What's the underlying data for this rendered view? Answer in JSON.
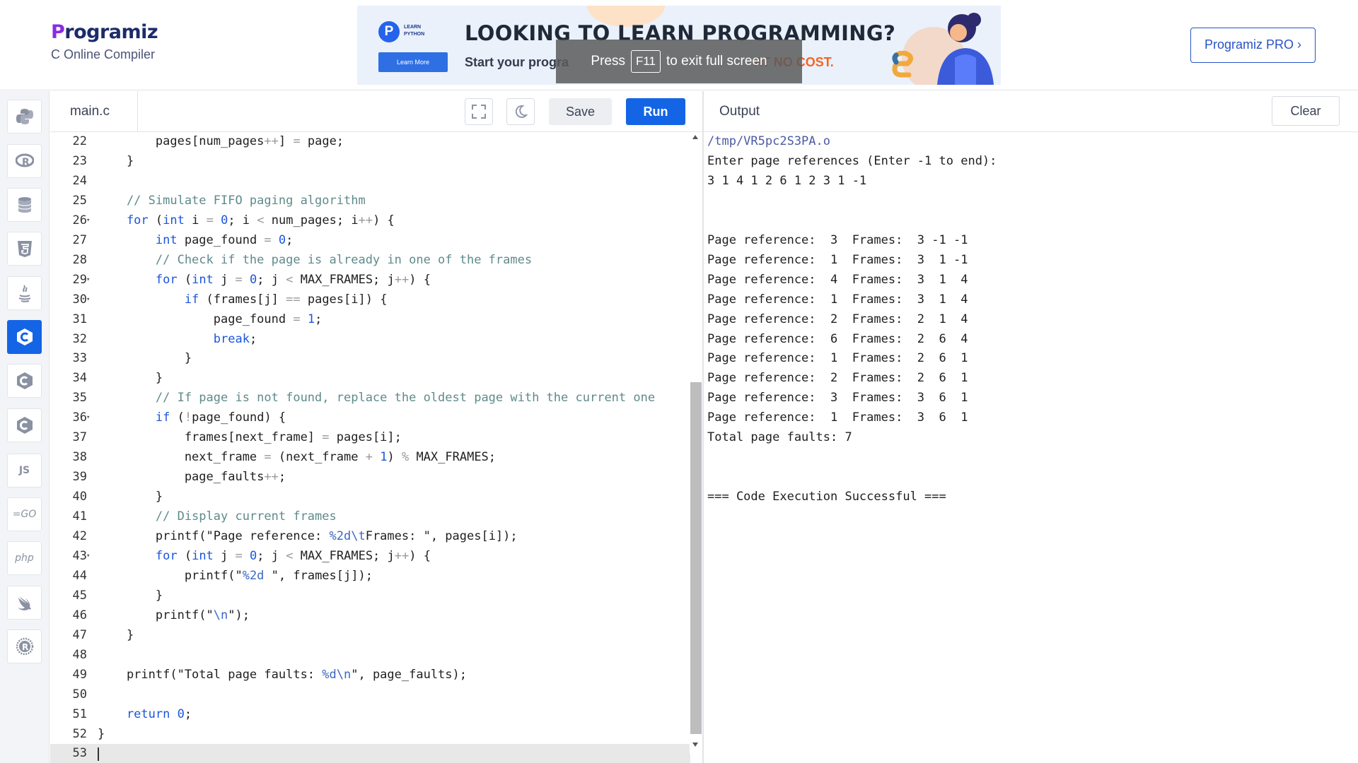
{
  "header": {
    "logo_text": "Programiz",
    "subtitle": "C Online Compiler",
    "pro_button": "Programiz PRO ›"
  },
  "banner": {
    "badge_text_1": "LEARN",
    "badge_text_2": "PYTHON",
    "badge_button": "Learn More",
    "headline": "LOOKING TO LEARN PROGRAMMING?",
    "subline_prefix": "Start your progra",
    "subline_highlight": "AT NO COST."
  },
  "toast": {
    "before": "Press",
    "key": "F11",
    "after": "to exit full screen"
  },
  "sidebar": {
    "items": [
      {
        "name": "python",
        "icon": "python-icon"
      },
      {
        "name": "r",
        "icon": "r-icon"
      },
      {
        "name": "sql",
        "icon": "database-icon"
      },
      {
        "name": "html",
        "icon": "html5-icon"
      },
      {
        "name": "java",
        "icon": "java-icon"
      },
      {
        "name": "c",
        "icon": "c-icon",
        "active": true
      },
      {
        "name": "cpp",
        "icon": "cpp-icon"
      },
      {
        "name": "csharp",
        "icon": "csharp-icon"
      },
      {
        "name": "js",
        "icon": "js-icon",
        "label": "JS"
      },
      {
        "name": "go",
        "icon": "go-icon",
        "label": "GO"
      },
      {
        "name": "php",
        "icon": "php-icon",
        "label": "php"
      },
      {
        "name": "swift",
        "icon": "swift-icon"
      },
      {
        "name": "rust",
        "icon": "rust-icon"
      }
    ]
  },
  "editor": {
    "file_tab": "main.c",
    "save_label": "Save",
    "run_label": "Run",
    "current_line": 53,
    "lines": [
      {
        "n": "22",
        "fold": false,
        "code": [
          [
            "",
            "        pages[num_pages"
          ],
          [
            "o",
            "++"
          ],
          [
            "",
            "] "
          ],
          [
            "o",
            "="
          ],
          [
            "",
            " page;"
          ]
        ]
      },
      {
        "n": "23",
        "fold": false,
        "code": [
          [
            "",
            "    }"
          ]
        ]
      },
      {
        "n": "24",
        "fold": false,
        "code": []
      },
      {
        "n": "25",
        "fold": false,
        "code": [
          [
            "c",
            "    // Simulate FIFO paging algorithm"
          ]
        ]
      },
      {
        "n": "26",
        "fold": true,
        "code": [
          [
            "k",
            "    for"
          ],
          [
            "",
            " ("
          ],
          [
            "k",
            "int"
          ],
          [
            "",
            " i "
          ],
          [
            "o",
            "="
          ],
          [
            "",
            " "
          ],
          [
            "n",
            "0"
          ],
          [
            "",
            "; i "
          ],
          [
            "o",
            "<"
          ],
          [
            "",
            " num_pages; i"
          ],
          [
            "o",
            "++"
          ],
          [
            "",
            ") {"
          ]
        ]
      },
      {
        "n": "27",
        "fold": false,
        "code": [
          [
            "k",
            "        int"
          ],
          [
            "",
            " page_found "
          ],
          [
            "o",
            "="
          ],
          [
            "",
            " "
          ],
          [
            "n",
            "0"
          ],
          [
            "",
            ";"
          ]
        ]
      },
      {
        "n": "28",
        "fold": false,
        "code": [
          [
            "c",
            "        // Check if the page is already in one of the frames"
          ]
        ]
      },
      {
        "n": "29",
        "fold": true,
        "code": [
          [
            "k",
            "        for"
          ],
          [
            "",
            " ("
          ],
          [
            "k",
            "int"
          ],
          [
            "",
            " j "
          ],
          [
            "o",
            "="
          ],
          [
            "",
            " "
          ],
          [
            "n",
            "0"
          ],
          [
            "",
            "; j "
          ],
          [
            "o",
            "<"
          ],
          [
            "",
            " MAX_FRAMES; j"
          ],
          [
            "o",
            "++"
          ],
          [
            "",
            ") {"
          ]
        ]
      },
      {
        "n": "30",
        "fold": true,
        "code": [
          [
            "k",
            "            if"
          ],
          [
            "",
            " (frames[j] "
          ],
          [
            "o",
            "=="
          ],
          [
            "",
            " pages[i]) {"
          ]
        ]
      },
      {
        "n": "31",
        "fold": false,
        "code": [
          [
            "",
            "                page_found "
          ],
          [
            "o",
            "="
          ],
          [
            "",
            " "
          ],
          [
            "n",
            "1"
          ],
          [
            "",
            ";"
          ]
        ]
      },
      {
        "n": "32",
        "fold": false,
        "code": [
          [
            "k",
            "                break"
          ],
          [
            "",
            ";"
          ]
        ]
      },
      {
        "n": "33",
        "fold": false,
        "code": [
          [
            "",
            "            }"
          ]
        ]
      },
      {
        "n": "34",
        "fold": false,
        "code": [
          [
            "",
            "        }"
          ]
        ]
      },
      {
        "n": "35",
        "fold": false,
        "code": [
          [
            "c",
            "        // If page is not found, replace the oldest page with the current one"
          ]
        ]
      },
      {
        "n": "36",
        "fold": true,
        "code": [
          [
            "k",
            "        if"
          ],
          [
            "",
            " ("
          ],
          [
            "o",
            "!"
          ],
          [
            "",
            "page_found) {"
          ]
        ]
      },
      {
        "n": "37",
        "fold": false,
        "code": [
          [
            "",
            "            frames[next_frame] "
          ],
          [
            "o",
            "="
          ],
          [
            "",
            " pages[i];"
          ]
        ]
      },
      {
        "n": "38",
        "fold": false,
        "code": [
          [
            "",
            "            next_frame "
          ],
          [
            "o",
            "="
          ],
          [
            "",
            " (next_frame "
          ],
          [
            "o",
            "+"
          ],
          [
            "",
            " "
          ],
          [
            "n",
            "1"
          ],
          [
            "",
            ") "
          ],
          [
            "o",
            "%"
          ],
          [
            "",
            " MAX_FRAMES;"
          ]
        ]
      },
      {
        "n": "39",
        "fold": false,
        "code": [
          [
            "",
            "            page_faults"
          ],
          [
            "o",
            "++"
          ],
          [
            "",
            ";"
          ]
        ]
      },
      {
        "n": "40",
        "fold": false,
        "code": [
          [
            "",
            "        }"
          ]
        ]
      },
      {
        "n": "41",
        "fold": false,
        "code": [
          [
            "c",
            "        // Display current frames"
          ]
        ]
      },
      {
        "n": "42",
        "fold": false,
        "code": [
          [
            "",
            "        printf(\"Page reference: "
          ],
          [
            "fmt",
            "%2d\\t"
          ],
          [
            "",
            "Frames: \", pages[i]);"
          ]
        ]
      },
      {
        "n": "43",
        "fold": true,
        "code": [
          [
            "k",
            "        for"
          ],
          [
            "",
            " ("
          ],
          [
            "k",
            "int"
          ],
          [
            "",
            " j "
          ],
          [
            "o",
            "="
          ],
          [
            "",
            " "
          ],
          [
            "n",
            "0"
          ],
          [
            "",
            "; j "
          ],
          [
            "o",
            "<"
          ],
          [
            "",
            " MAX_FRAMES; j"
          ],
          [
            "o",
            "++"
          ],
          [
            "",
            ") {"
          ]
        ]
      },
      {
        "n": "44",
        "fold": false,
        "code": [
          [
            "",
            "            printf(\""
          ],
          [
            "fmt",
            "%2d"
          ],
          [
            "",
            " \", frames[j]);"
          ]
        ]
      },
      {
        "n": "45",
        "fold": false,
        "code": [
          [
            "",
            "        }"
          ]
        ]
      },
      {
        "n": "46",
        "fold": false,
        "code": [
          [
            "",
            "        printf(\""
          ],
          [
            "fmt",
            "\\n"
          ],
          [
            "",
            "\");"
          ]
        ]
      },
      {
        "n": "47",
        "fold": false,
        "code": [
          [
            "",
            "    }"
          ]
        ]
      },
      {
        "n": "48",
        "fold": false,
        "code": []
      },
      {
        "n": "49",
        "fold": false,
        "code": [
          [
            "",
            "    printf(\"Total page faults: "
          ],
          [
            "fmt",
            "%d\\n"
          ],
          [
            "",
            "\", page_faults);"
          ]
        ]
      },
      {
        "n": "50",
        "fold": false,
        "code": []
      },
      {
        "n": "51",
        "fold": false,
        "code": [
          [
            "k",
            "    return"
          ],
          [
            "",
            " "
          ],
          [
            "n",
            "0"
          ],
          [
            "",
            ";"
          ]
        ]
      },
      {
        "n": "52",
        "fold": false,
        "code": [
          [
            "",
            "}"
          ]
        ]
      },
      {
        "n": "53",
        "fold": false,
        "code": []
      }
    ]
  },
  "output": {
    "title": "Output",
    "clear_label": "Clear",
    "lines": [
      {
        "text": "/tmp/VR5pc2S3PA.o",
        "path": true
      },
      {
        "text": "Enter page references (Enter -1 to end):"
      },
      {
        "text": "3 1 4 1 2 6 1 2 3 1 -1"
      },
      {
        "text": ""
      },
      {
        "text": ""
      },
      {
        "text": "Page reference:  3  Frames:  3 -1 -1"
      },
      {
        "text": "Page reference:  1  Frames:  3  1 -1"
      },
      {
        "text": "Page reference:  4  Frames:  3  1  4"
      },
      {
        "text": "Page reference:  1  Frames:  3  1  4"
      },
      {
        "text": "Page reference:  2  Frames:  2  1  4"
      },
      {
        "text": "Page reference:  6  Frames:  2  6  4"
      },
      {
        "text": "Page reference:  1  Frames:  2  6  1"
      },
      {
        "text": "Page reference:  2  Frames:  2  6  1"
      },
      {
        "text": "Page reference:  3  Frames:  3  6  1"
      },
      {
        "text": "Page reference:  1  Frames:  3  6  1"
      },
      {
        "text": "Total page faults: 7"
      },
      {
        "text": ""
      },
      {
        "text": ""
      },
      {
        "text": "=== Code Execution Successful ==="
      }
    ]
  },
  "colors": {
    "accent": "#1464e6",
    "brand_purple": "#8a2be2",
    "brand_navy": "#1c2b6b",
    "banner_orange": "#f26522"
  }
}
